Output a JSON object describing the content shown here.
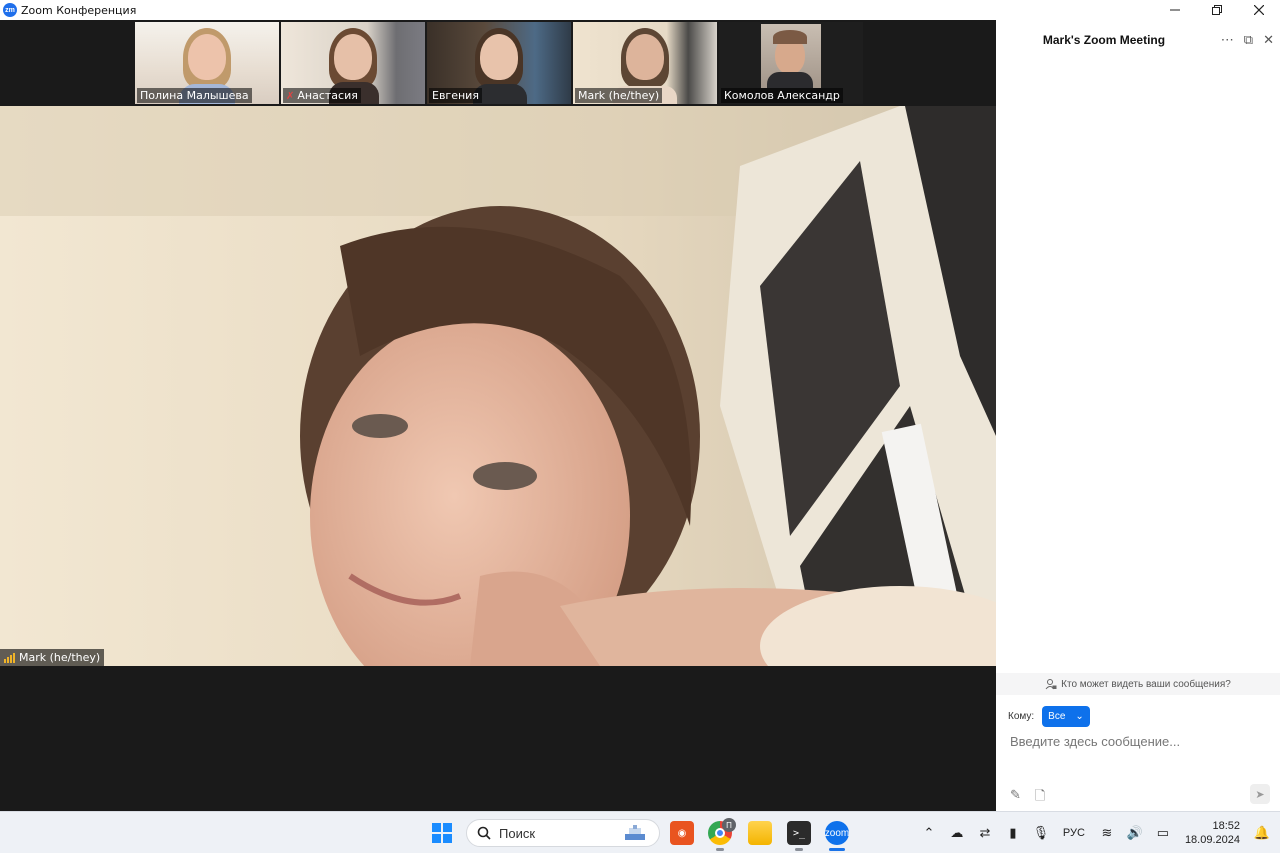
{
  "window": {
    "title": "Zoom Конференция",
    "app_icon": "zm"
  },
  "participants": [
    {
      "name": "Полина Малышева",
      "mic_muted": false,
      "active_speaker": true
    },
    {
      "name": "Анастасия",
      "mic_muted": true,
      "active_speaker": false
    },
    {
      "name": "Евгения",
      "mic_muted": false,
      "active_speaker": false
    },
    {
      "name": "Mark (he/they)",
      "mic_muted": false,
      "active_speaker": false
    },
    {
      "name": "Комолов Александр",
      "mic_muted": false,
      "active_speaker": false
    }
  ],
  "main_video": {
    "name": "Mark (he/they)",
    "signal_strength": 4
  },
  "chat": {
    "title": "Mark's Zoom Meeting",
    "privacy_text": "Кто может видеть ваши сообщения?",
    "to_label": "Кому:",
    "to_value": "Все",
    "input_placeholder": "Введите здесь сообщение..."
  },
  "taskbar": {
    "search_placeholder": "Поиск",
    "chrome_badge": "П",
    "language": "РУС",
    "time": "18:52",
    "date": "18.09.2024"
  },
  "colors": {
    "zoom_blue": "#0e71eb",
    "active_speaker_border": "#8bc34a",
    "mic_off": "#e04343"
  }
}
